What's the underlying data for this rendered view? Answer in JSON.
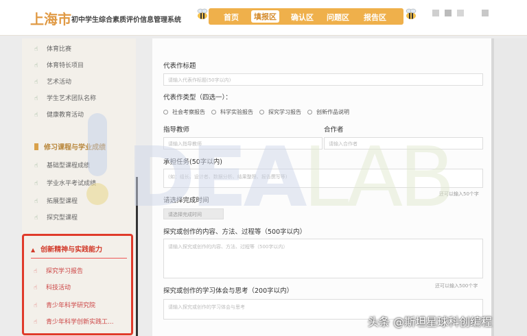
{
  "header": {
    "city": "上海市",
    "system_name": "初中学生综合素质评价信息管理系统",
    "nav": [
      "首页",
      "填报区",
      "确认区",
      "问题区",
      "报告区"
    ],
    "active_nav": "填报区"
  },
  "sidebar": {
    "top_items": [
      "体育比赛",
      "体育特长项目",
      "艺术活动",
      "学生艺术团队名称",
      "健康教育活动"
    ],
    "section2": "修习课程与学业成绩",
    "section2_items": [
      "基础型课程成绩",
      "学业水平考试成绩",
      "拓展型课程",
      "探究型课程"
    ],
    "section3": "创新精神与实践能力",
    "section3_items": [
      "探究学习报告",
      "科技活动",
      "青少年科学研究院",
      "青少年科学创新实践工..."
    ]
  },
  "form": {
    "work_title_label": "代表作标题",
    "work_title_placeholder": "请输入代表作标题(50字以内)",
    "work_type_label": "代表作类型（四选一）：",
    "work_types": [
      "社会考察报告",
      "科学实验报告",
      "探究学习报告",
      "创新作品说明"
    ],
    "teacher_label": "指导教师",
    "teacher_placeholder": "请输入指导教师",
    "partner_label": "合作者",
    "partner_placeholder": "请输入合作者",
    "task_label": "承担任务(50字以内)",
    "task_placeholder": "(如：组长、设计者、数据分析、结果整理、报告撰写等)",
    "task_hint": "还可以输入50个字",
    "date_label": "请选择完成时间",
    "date_placeholder": "请选择完成时间",
    "process_label": "探究或创作的内容、方法、过程等（500字以内）",
    "process_placeholder": "请输入探究或创作的内容、方法、过程等（500字以内）",
    "process_hint": "还可以输入500个字",
    "reflection_label": "探究或创作的学习体会与思考（200字以内）",
    "reflection_placeholder": "请输入探究或创作的学习体会与思考"
  },
  "watermark": {
    "letters_1": "DEA",
    "letters_2": "LAB",
    "caption": "头条 @斯坦星球科创编程"
  }
}
